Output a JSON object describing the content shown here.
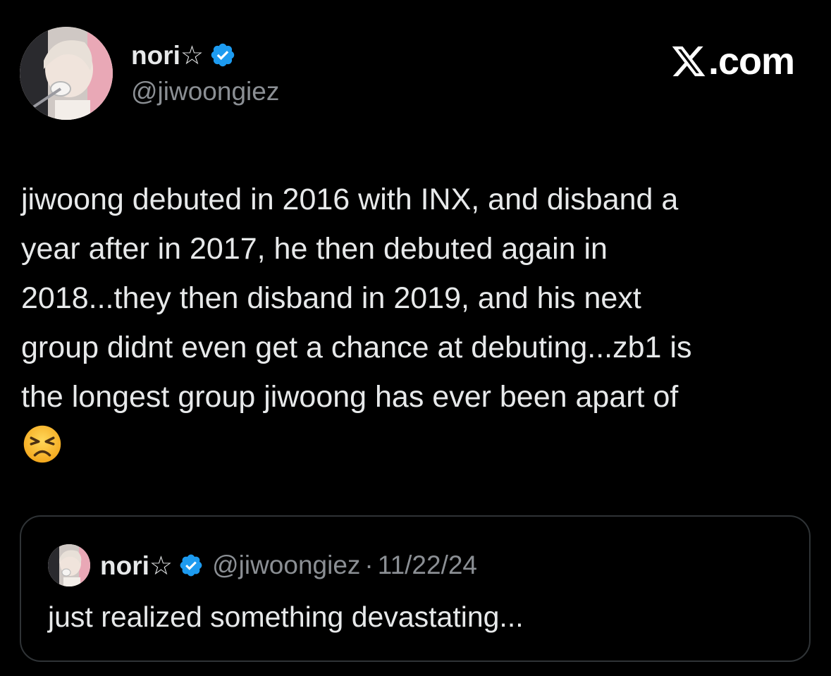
{
  "author": {
    "display_name": "nori☆",
    "handle": "@jiwoongiez",
    "verified": true,
    "avatar_icon": "profile-photo"
  },
  "brand": {
    "label": ".com",
    "logo_icon": "x-logo-icon"
  },
  "tweet": {
    "text": "jiwoong debuted in 2016 with INX, and disband a\nyear after in 2017, he then debuted again in\n2018...they then disband in 2019, and his next\ngroup didnt even get a chance at debuting...zb1 is\nthe longest group jiwoong has ever been apart of",
    "emoji": "persevering-face-emoji"
  },
  "quoted_tweet": {
    "display_name": "nori☆",
    "handle": "@jiwoongiez",
    "separator": "·",
    "date": "11/22/24",
    "text": "just realized something devastating..."
  },
  "colors": {
    "background": "#000000",
    "text": "#e7e9ea",
    "secondary_text": "#8b8f94",
    "verified_blue": "#1d9bf0",
    "border": "#2f3336"
  }
}
